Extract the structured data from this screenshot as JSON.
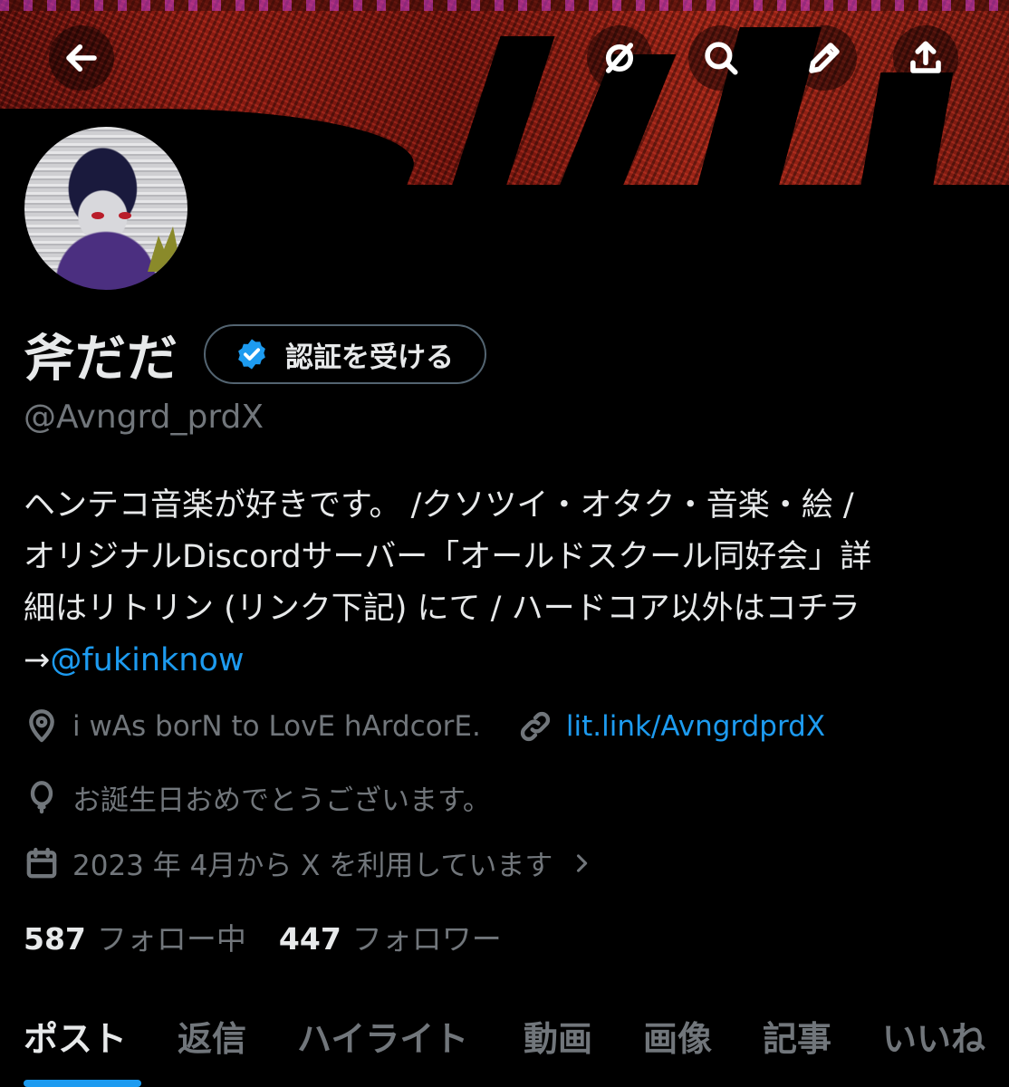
{
  "header": {
    "back_icon": "arrow-left-icon",
    "grok_icon": "grok-icon",
    "search_icon": "search-icon",
    "edit_icon": "pencil-icon",
    "share_icon": "share-icon"
  },
  "profile": {
    "display_name": "斧だだ",
    "verify_label": "認証を受ける",
    "handle": "@Avngrd_prdX",
    "bio": {
      "line1": "ヘンテコ音楽が好きです。 /クソツイ・オタク・音楽・絵 /",
      "line2": "オリジナルDiscordサーバー「オールドスクール同好会」詳",
      "line3": "細はリトリン (リンク下記) にて / ハードコア以外はコチラ",
      "line4_prefix": "→",
      "line4_link": "@fukinknow"
    },
    "location": "i wAs borN to LovE hArdcorE.",
    "website": "lit.link/AvngrdprdX",
    "birthday": "お誕生日おめでとうございます。",
    "joined": "2023 年 4月から X を利用しています",
    "following_count": "587",
    "following_label": "フォロー中",
    "followers_count": "447",
    "followers_label": "フォロワー"
  },
  "tabs": [
    {
      "label": "ポスト",
      "active": true
    },
    {
      "label": "返信"
    },
    {
      "label": "ハイライト"
    },
    {
      "label": "動画"
    },
    {
      "label": "画像"
    },
    {
      "label": "記事"
    },
    {
      "label": "いいね"
    }
  ],
  "colors": {
    "accent": "#1d9bf0",
    "text_primary": "#e7e9ea",
    "text_secondary": "#71767b",
    "background": "#000000"
  }
}
